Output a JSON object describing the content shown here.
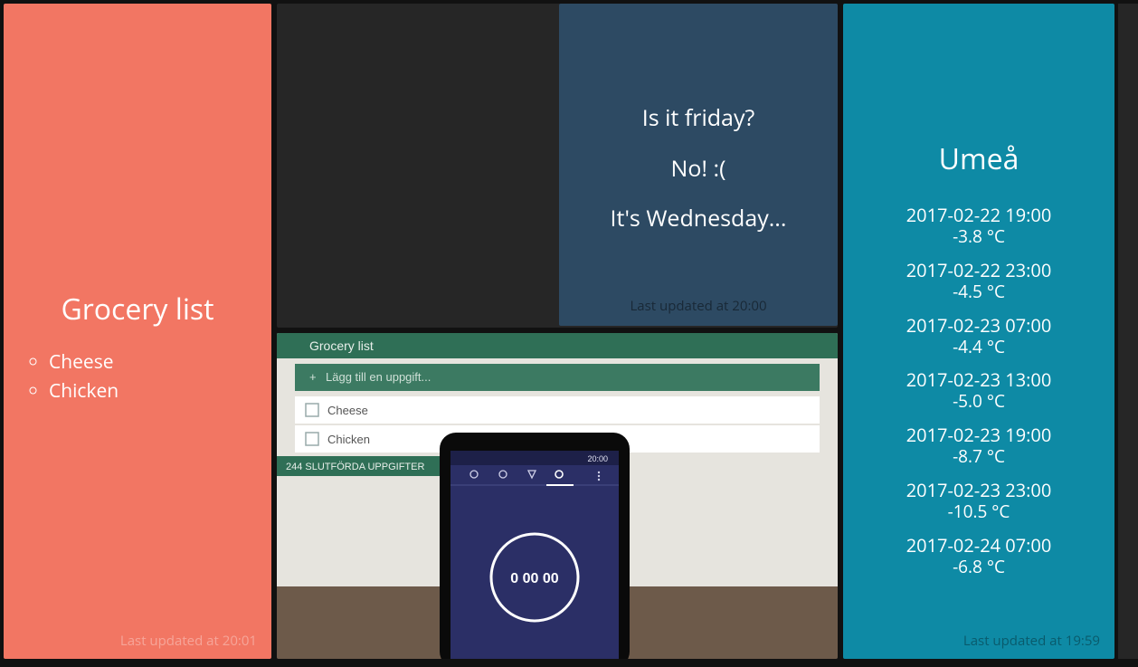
{
  "grocery": {
    "title": "Grocery list",
    "items": [
      "Cheese",
      "Chicken"
    ],
    "updated": "Last updated at 20:01"
  },
  "friday": {
    "question": "Is it friday?",
    "answer": "No! :(",
    "day_line": "It's Wednesday...",
    "updated": "Last updated at 20:00"
  },
  "weather": {
    "location": "Umeå",
    "forecast": [
      {
        "dt": "2017-02-22 19:00",
        "temp": "-3.8 °C"
      },
      {
        "dt": "2017-02-22 23:00",
        "temp": "-4.5 °C"
      },
      {
        "dt": "2017-02-23 07:00",
        "temp": "-4.4 °C"
      },
      {
        "dt": "2017-02-23 13:00",
        "temp": "-5.0 °C"
      },
      {
        "dt": "2017-02-23 19:00",
        "temp": "-8.7 °C"
      },
      {
        "dt": "2017-02-23 23:00",
        "temp": "-10.5 °C"
      },
      {
        "dt": "2017-02-24 07:00",
        "temp": "-6.8 °C"
      }
    ],
    "updated": "Last updated at 19:59"
  },
  "photo": {
    "app_title": "Grocery list",
    "add_task": "Lägg till en uppgift...",
    "rows": [
      "Cheese",
      "Chicken"
    ],
    "completed_label": "244 SLUTFÖRDA UPPGIFTER",
    "phone_status_time": "20:00",
    "timer_value": "0 00 00"
  }
}
